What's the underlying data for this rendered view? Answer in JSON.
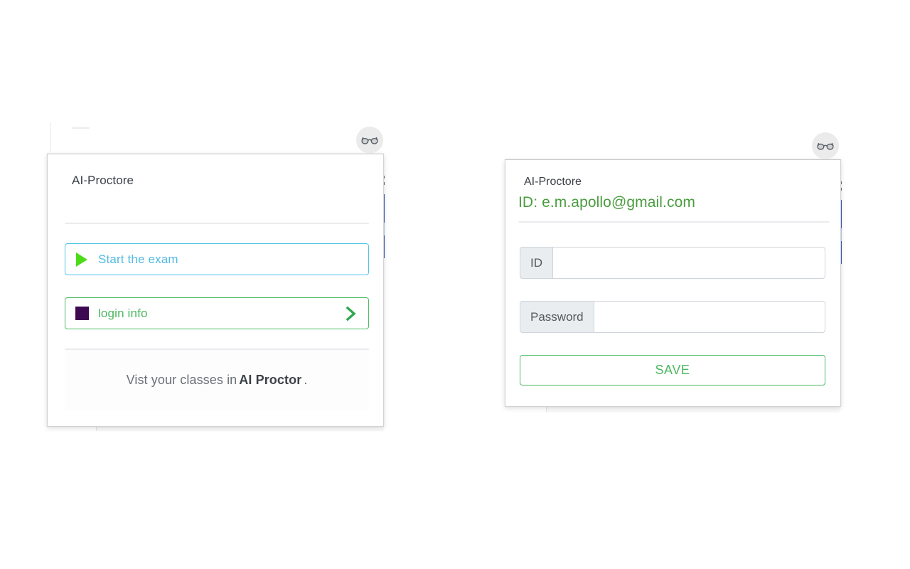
{
  "colors": {
    "accent_green": "#4cb860",
    "accent_blue": "#52b9e0",
    "play_green": "#4ddb18",
    "purple_square": "#3d0a52",
    "id_text_green": "#4a9d3f",
    "title_gray": "#3b3f46",
    "badge_gray": "#ebebeb"
  },
  "left_popup": {
    "badge_icon": "glasses-icon",
    "brand_title": "AI-Proctore",
    "actions": [
      {
        "id": "start-exam",
        "label": "Start the exam",
        "icon": "play-triangle-icon",
        "has_chevron": false,
        "border_color": "#4fc3e8",
        "text_color": "#52b9e0"
      },
      {
        "id": "login-info",
        "label": "login info",
        "icon": "purple-square-icon",
        "has_chevron": true,
        "chevron_icon": "chevron-right-icon",
        "border_color": "#4cbb63",
        "text_color": "#4cb860"
      }
    ],
    "footer": {
      "prefix": "Vist your classes in",
      "emphasis": "AI Proctor",
      "suffix": "."
    }
  },
  "right_popup": {
    "badge_icon": "glasses-icon",
    "brand_title": "AI-Proctore",
    "id_line": "ID: e.m.apollo@gmail.com",
    "fields": [
      {
        "id": "id-field",
        "prefix_label": "ID",
        "value": "",
        "placeholder": ""
      },
      {
        "id": "password-field",
        "prefix_label": "Password",
        "value": "",
        "placeholder": ""
      }
    ],
    "save_button_label": "SAVE"
  }
}
